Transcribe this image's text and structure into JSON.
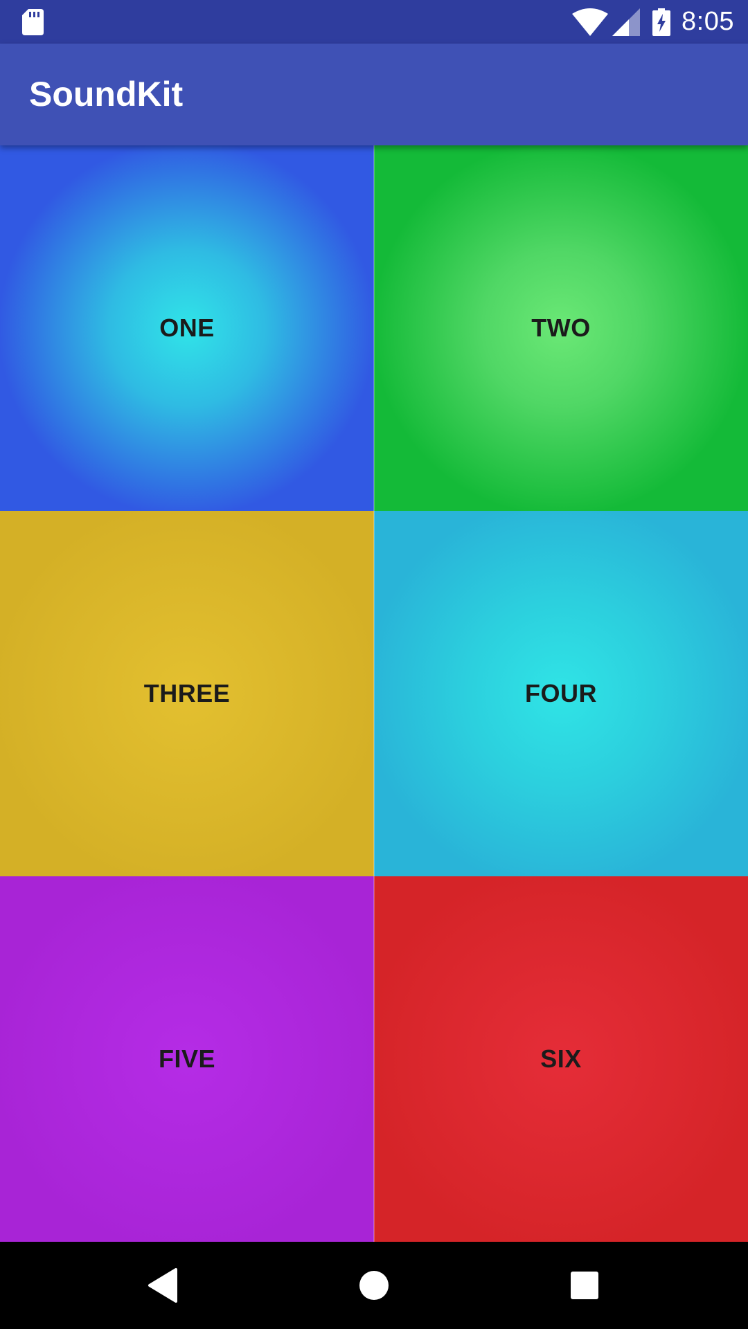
{
  "status_bar": {
    "time": "8:05",
    "icons": [
      "sd-card-icon",
      "wifi-icon",
      "signal-icon",
      "battery-charging-icon"
    ]
  },
  "app_bar": {
    "title": "SoundKit"
  },
  "pads": [
    {
      "label": "ONE",
      "color": "#3159e3"
    },
    {
      "label": "TWO",
      "color": "#14ba38"
    },
    {
      "label": "THREE",
      "color": "#d4b026"
    },
    {
      "label": "FOUR",
      "color": "#29b4d8"
    },
    {
      "label": "FIVE",
      "color": "#a824d6"
    },
    {
      "label": "SIX",
      "color": "#d52428"
    }
  ],
  "nav_bar": {
    "buttons": [
      "back-icon",
      "home-icon",
      "recents-icon"
    ]
  },
  "colors": {
    "status_bar": "#2f3d9e",
    "app_bar": "#3f51b5",
    "nav_bar": "#000000"
  }
}
